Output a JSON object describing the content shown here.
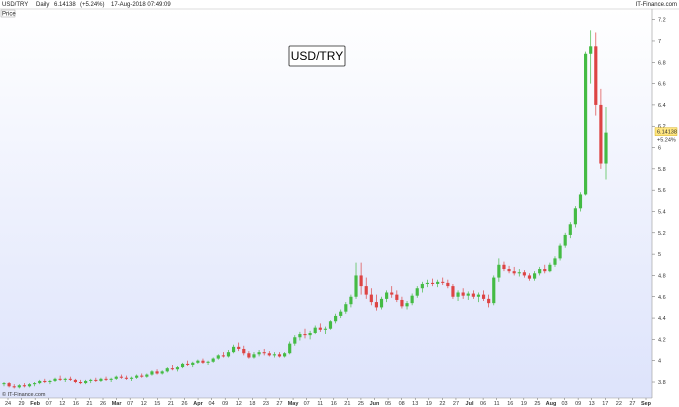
{
  "header": {
    "symbol": "USD/TRY",
    "interval": "Daily",
    "last_price": "6.14138",
    "change": "(+5.24%)",
    "datetime": "17-Aug-2018 07:49:09",
    "brand": "IT-Finance.com",
    "price_label": "Price"
  },
  "watermark": "© IT-Finance.com",
  "chart_data": {
    "type": "candlestick",
    "title": "USD/TRY",
    "ylim": [
      3.65,
      7.3
    ],
    "y_ticks": [
      3.8,
      4,
      4.2,
      4.4,
      4.6,
      4.8,
      5,
      5.2,
      5.4,
      5.6,
      5.8,
      6,
      6.2,
      6.4,
      6.6,
      6.8,
      7,
      7.2
    ],
    "x_tick_labels": [
      "24",
      "29",
      "Feb",
      "07",
      "12",
      "16",
      "21",
      "26",
      "Mar",
      "07",
      "12",
      "15",
      "21",
      "26",
      "Apr",
      "04",
      "09",
      "12",
      "18",
      "23",
      "27",
      "May",
      "07",
      "11",
      "16",
      "21",
      "25",
      "Jun",
      "05",
      "08",
      "13",
      "19",
      "22",
      "27",
      "Jul",
      "06",
      "11",
      "16",
      "19",
      "25",
      "Aug",
      "03",
      "09",
      "13",
      "17",
      "22",
      "27",
      "Sep"
    ],
    "last_price_label": "6.14138",
    "last_change_label": "+5.24%",
    "colors": {
      "up": "#44bb44",
      "down": "#dd4444",
      "background_top": "#ffffff",
      "background_bottom": "#dde3fb"
    },
    "candles": [
      [
        3.78,
        3.8,
        3.76,
        3.79
      ],
      [
        3.79,
        3.8,
        3.75,
        3.76
      ],
      [
        3.76,
        3.78,
        3.74,
        3.75
      ],
      [
        3.75,
        3.78,
        3.74,
        3.77
      ],
      [
        3.77,
        3.79,
        3.75,
        3.76
      ],
      [
        3.76,
        3.79,
        3.75,
        3.78
      ],
      [
        3.78,
        3.8,
        3.76,
        3.79
      ],
      [
        3.79,
        3.82,
        3.78,
        3.81
      ],
      [
        3.81,
        3.83,
        3.79,
        3.8
      ],
      [
        3.8,
        3.82,
        3.78,
        3.81
      ],
      [
        3.81,
        3.84,
        3.8,
        3.83
      ],
      [
        3.83,
        3.86,
        3.81,
        3.82
      ],
      [
        3.82,
        3.84,
        3.8,
        3.83
      ],
      [
        3.83,
        3.85,
        3.81,
        3.82
      ],
      [
        3.82,
        3.83,
        3.79,
        3.8
      ],
      [
        3.8,
        3.82,
        3.78,
        3.79
      ],
      [
        3.79,
        3.82,
        3.78,
        3.81
      ],
      [
        3.81,
        3.83,
        3.79,
        3.82
      ],
      [
        3.82,
        3.84,
        3.8,
        3.81
      ],
      [
        3.81,
        3.84,
        3.8,
        3.83
      ],
      [
        3.83,
        3.85,
        3.81,
        3.82
      ],
      [
        3.82,
        3.84,
        3.8,
        3.83
      ],
      [
        3.83,
        3.86,
        3.82,
        3.85
      ],
      [
        3.85,
        3.87,
        3.83,
        3.84
      ],
      [
        3.84,
        3.86,
        3.82,
        3.83
      ],
      [
        3.83,
        3.85,
        3.81,
        3.84
      ],
      [
        3.84,
        3.87,
        3.83,
        3.86
      ],
      [
        3.86,
        3.88,
        3.84,
        3.85
      ],
      [
        3.85,
        3.88,
        3.84,
        3.87
      ],
      [
        3.87,
        3.91,
        3.86,
        3.9
      ],
      [
        3.9,
        3.92,
        3.87,
        3.88
      ],
      [
        3.88,
        3.91,
        3.87,
        3.9
      ],
      [
        3.9,
        3.94,
        3.89,
        3.93
      ],
      [
        3.93,
        3.96,
        3.91,
        3.92
      ],
      [
        3.92,
        3.95,
        3.9,
        3.94
      ],
      [
        3.94,
        3.98,
        3.93,
        3.97
      ],
      [
        3.97,
        4.0,
        3.95,
        3.96
      ],
      [
        3.96,
        3.99,
        3.94,
        3.98
      ],
      [
        3.98,
        4.01,
        3.97,
        4.0
      ],
      [
        4.0,
        4.02,
        3.97,
        3.98
      ],
      [
        3.98,
        4.0,
        3.96,
        3.99
      ],
      [
        3.99,
        4.03,
        3.98,
        4.02
      ],
      [
        4.02,
        4.06,
        4.01,
        4.05
      ],
      [
        4.05,
        4.08,
        4.03,
        4.04
      ],
      [
        4.04,
        4.1,
        4.03,
        4.08
      ],
      [
        4.08,
        4.15,
        4.07,
        4.13
      ],
      [
        4.13,
        4.17,
        4.09,
        4.11
      ],
      [
        4.11,
        4.14,
        4.05,
        4.07
      ],
      [
        4.07,
        4.09,
        4.02,
        4.03
      ],
      [
        4.03,
        4.08,
        4.02,
        4.06
      ],
      [
        4.06,
        4.1,
        4.04,
        4.08
      ],
      [
        4.08,
        4.11,
        4.05,
        4.07
      ],
      [
        4.07,
        4.09,
        4.04,
        4.05
      ],
      [
        4.05,
        4.08,
        4.03,
        4.06
      ],
      [
        4.06,
        4.08,
        4.03,
        4.04
      ],
      [
        4.04,
        4.08,
        4.03,
        4.07
      ],
      [
        4.07,
        4.18,
        4.06,
        4.16
      ],
      [
        4.16,
        4.24,
        4.14,
        4.22
      ],
      [
        4.22,
        4.27,
        4.19,
        4.25
      ],
      [
        4.25,
        4.3,
        4.21,
        4.24
      ],
      [
        4.24,
        4.28,
        4.2,
        4.26
      ],
      [
        4.26,
        4.33,
        4.25,
        4.31
      ],
      [
        4.31,
        4.35,
        4.27,
        4.29
      ],
      [
        4.29,
        4.32,
        4.25,
        4.3
      ],
      [
        4.3,
        4.38,
        4.29,
        4.37
      ],
      [
        4.37,
        4.44,
        4.35,
        4.42
      ],
      [
        4.42,
        4.48,
        4.4,
        4.46
      ],
      [
        4.46,
        4.55,
        4.44,
        4.53
      ],
      [
        4.53,
        4.62,
        4.5,
        4.6
      ],
      [
        4.6,
        4.92,
        4.58,
        4.8
      ],
      [
        4.8,
        4.92,
        4.62,
        4.7
      ],
      [
        4.7,
        4.78,
        4.58,
        4.62
      ],
      [
        4.62,
        4.68,
        4.52,
        4.55
      ],
      [
        4.55,
        4.62,
        4.47,
        4.5
      ],
      [
        4.5,
        4.6,
        4.48,
        4.58
      ],
      [
        4.58,
        4.66,
        4.55,
        4.64
      ],
      [
        4.64,
        4.7,
        4.59,
        4.62
      ],
      [
        4.62,
        4.66,
        4.55,
        4.57
      ],
      [
        4.57,
        4.6,
        4.49,
        4.51
      ],
      [
        4.51,
        4.56,
        4.48,
        4.54
      ],
      [
        4.54,
        4.63,
        4.52,
        4.61
      ],
      [
        4.61,
        4.7,
        4.59,
        4.68
      ],
      [
        4.68,
        4.74,
        4.64,
        4.72
      ],
      [
        4.72,
        4.76,
        4.69,
        4.73
      ],
      [
        4.73,
        4.77,
        4.7,
        4.72
      ],
      [
        4.72,
        4.76,
        4.69,
        4.74
      ],
      [
        4.74,
        4.78,
        4.71,
        4.73
      ],
      [
        4.73,
        4.76,
        4.68,
        4.7
      ],
      [
        4.7,
        4.72,
        4.58,
        4.6
      ],
      [
        4.6,
        4.66,
        4.56,
        4.64
      ],
      [
        4.64,
        4.68,
        4.58,
        4.61
      ],
      [
        4.61,
        4.65,
        4.57,
        4.63
      ],
      [
        4.63,
        4.66,
        4.58,
        4.6
      ],
      [
        4.6,
        4.64,
        4.55,
        4.62
      ],
      [
        4.62,
        4.66,
        4.56,
        4.58
      ],
      [
        4.58,
        4.62,
        4.5,
        4.54
      ],
      [
        4.54,
        4.8,
        4.52,
        4.78
      ],
      [
        4.78,
        4.96,
        4.74,
        4.9
      ],
      [
        4.9,
        4.93,
        4.84,
        4.86
      ],
      [
        4.86,
        4.89,
        4.82,
        4.84
      ],
      [
        4.84,
        4.88,
        4.8,
        4.82
      ],
      [
        4.82,
        4.86,
        4.79,
        4.83
      ],
      [
        4.83,
        4.85,
        4.78,
        4.8
      ],
      [
        4.8,
        4.82,
        4.75,
        4.77
      ],
      [
        4.77,
        4.84,
        4.75,
        4.82
      ],
      [
        4.82,
        4.88,
        4.8,
        4.86
      ],
      [
        4.86,
        4.9,
        4.82,
        4.84
      ],
      [
        4.84,
        4.92,
        4.83,
        4.9
      ],
      [
        4.9,
        4.98,
        4.88,
        4.96
      ],
      [
        4.96,
        5.1,
        4.94,
        5.08
      ],
      [
        5.08,
        5.2,
        5.06,
        5.18
      ],
      [
        5.18,
        5.3,
        5.15,
        5.28
      ],
      [
        5.28,
        5.45,
        5.25,
        5.43
      ],
      [
        5.43,
        5.58,
        5.4,
        5.56
      ],
      [
        5.56,
        6.9,
        5.55,
        6.88
      ],
      [
        6.88,
        7.1,
        6.6,
        6.95
      ],
      [
        6.95,
        7.08,
        6.3,
        6.4
      ],
      [
        6.4,
        6.55,
        5.8,
        5.85
      ],
      [
        5.85,
        6.38,
        5.7,
        6.14
      ]
    ]
  }
}
